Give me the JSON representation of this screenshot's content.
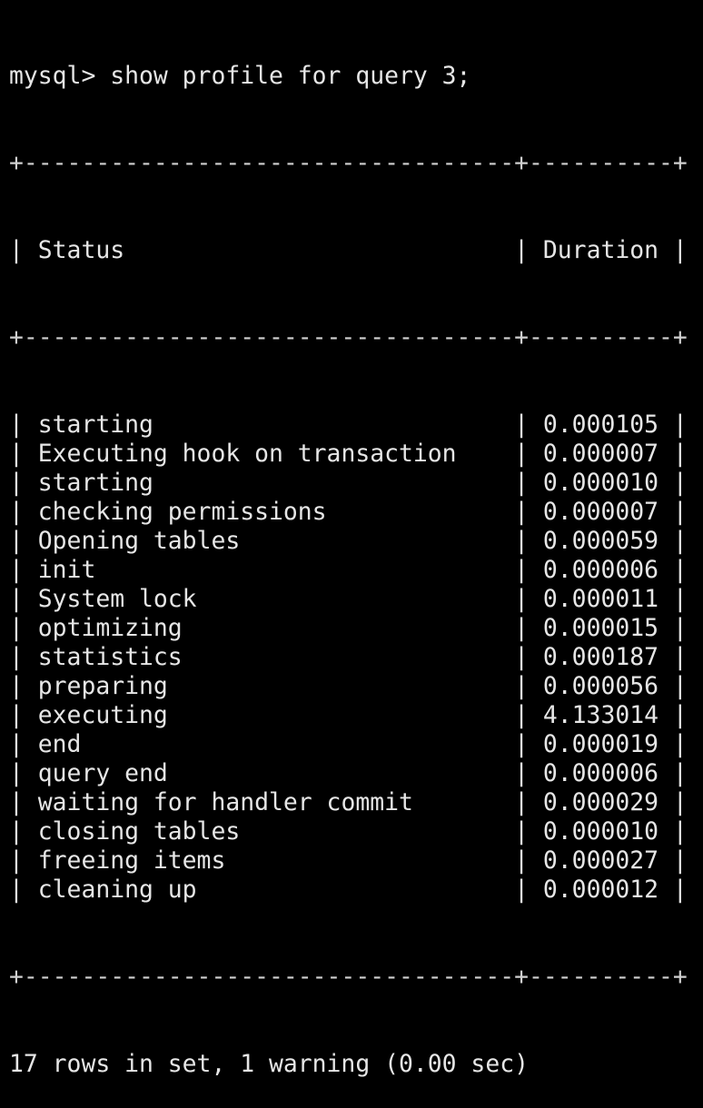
{
  "terminal": {
    "command": "mysql> show profile for query 3;",
    "border": "+----------------------------------+----------+",
    "header": {
      "status": "Status",
      "duration": "Duration"
    },
    "rows": [
      {
        "status": "starting",
        "duration": "0.000105"
      },
      {
        "status": "Executing hook on transaction",
        "duration": "0.000007"
      },
      {
        "status": "starting",
        "duration": "0.000010"
      },
      {
        "status": "checking permissions",
        "duration": "0.000007"
      },
      {
        "status": "Opening tables",
        "duration": "0.000059"
      },
      {
        "status": "init",
        "duration": "0.000006"
      },
      {
        "status": "System lock",
        "duration": "0.000011"
      },
      {
        "status": "optimizing",
        "duration": "0.000015"
      },
      {
        "status": "statistics",
        "duration": "0.000187"
      },
      {
        "status": "preparing",
        "duration": "0.000056"
      },
      {
        "status": "executing",
        "duration": "4.133014"
      },
      {
        "status": "end",
        "duration": "0.000019"
      },
      {
        "status": "query end",
        "duration": "0.000006"
      },
      {
        "status": "waiting for handler commit",
        "duration": "0.000029"
      },
      {
        "status": "closing tables",
        "duration": "0.000010"
      },
      {
        "status": "freeing items",
        "duration": "0.000027"
      },
      {
        "status": "cleaning up",
        "duration": "0.000012"
      }
    ],
    "footer": "17 rows in set, 1 warning (0.00 sec)"
  }
}
